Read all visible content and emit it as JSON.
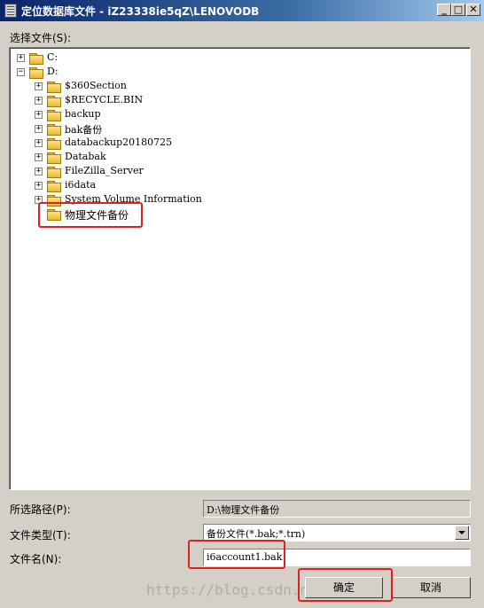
{
  "window": {
    "title": "定位数据库文件 - iZ23338ie5qZ\\LENOVODB",
    "controls": {
      "minimize": "_",
      "maximize": "□",
      "close": "✕"
    }
  },
  "select_file_label": "选择文件(S):",
  "tree": {
    "drives": [
      {
        "label": "C:",
        "expander": "+"
      },
      {
        "label": "D:",
        "expander": "−"
      }
    ],
    "d_children": [
      {
        "label": "$360Section",
        "expander": "+"
      },
      {
        "label": "$RECYCLE.BIN",
        "expander": "+"
      },
      {
        "label": "backup",
        "expander": "+"
      },
      {
        "label": "bak备份",
        "expander": "+"
      },
      {
        "label": "databackup20180725",
        "expander": "+"
      },
      {
        "label": "Databak",
        "expander": "+"
      },
      {
        "label": "FileZilla_Server",
        "expander": "+"
      },
      {
        "label": "i6data",
        "expander": "+"
      },
      {
        "label": "System Volume Information",
        "expander": "+"
      },
      {
        "label": "物理文件备份",
        "expander": ""
      }
    ]
  },
  "path_label": "所选路径(P):",
  "path_value": "D:\\物理文件备份",
  "file_type_label": "文件类型(T):",
  "file_type_value": "备份文件(*.bak;*.trn)",
  "file_name_label": "文件名(N):",
  "file_name_value": "i6account1.bak",
  "ok_button": "确定",
  "cancel_button": "取消",
  "watermark": "https://blog.csdn.net/a_va",
  "highlight_color": "#e02020"
}
